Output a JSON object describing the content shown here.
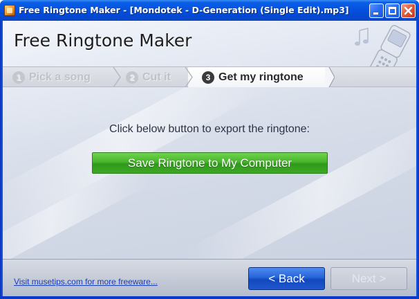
{
  "window": {
    "title": "Free Ringtone Maker - [Mondotek - D-Generation (Single Edit).mp3]",
    "app_icon": "app-icon",
    "controls": [
      "minimize-icon",
      "maximize-icon",
      "close-icon"
    ]
  },
  "header": {
    "app_name": "Free Ringtone Maker",
    "decoration_icon": "phone-music-icon"
  },
  "steps": [
    {
      "number": "1",
      "label": "Pick a song",
      "active": false
    },
    {
      "number": "2",
      "label": "Cut it",
      "active": false
    },
    {
      "number": "3",
      "label": "Get my ringtone",
      "active": true
    }
  ],
  "main": {
    "prompt": "Click below button to export the ringtone:",
    "save_label": "Save Ringtone to My Computer"
  },
  "footer": {
    "link_text": "Visit musetips.com for more freeware...",
    "back_label": "< Back",
    "next_label": "Next >",
    "next_enabled": false
  },
  "colors": {
    "titlebar": "#0552e0",
    "save_button": "#48b42c",
    "back_button": "#2563d8",
    "link": "#1a3fb5"
  }
}
